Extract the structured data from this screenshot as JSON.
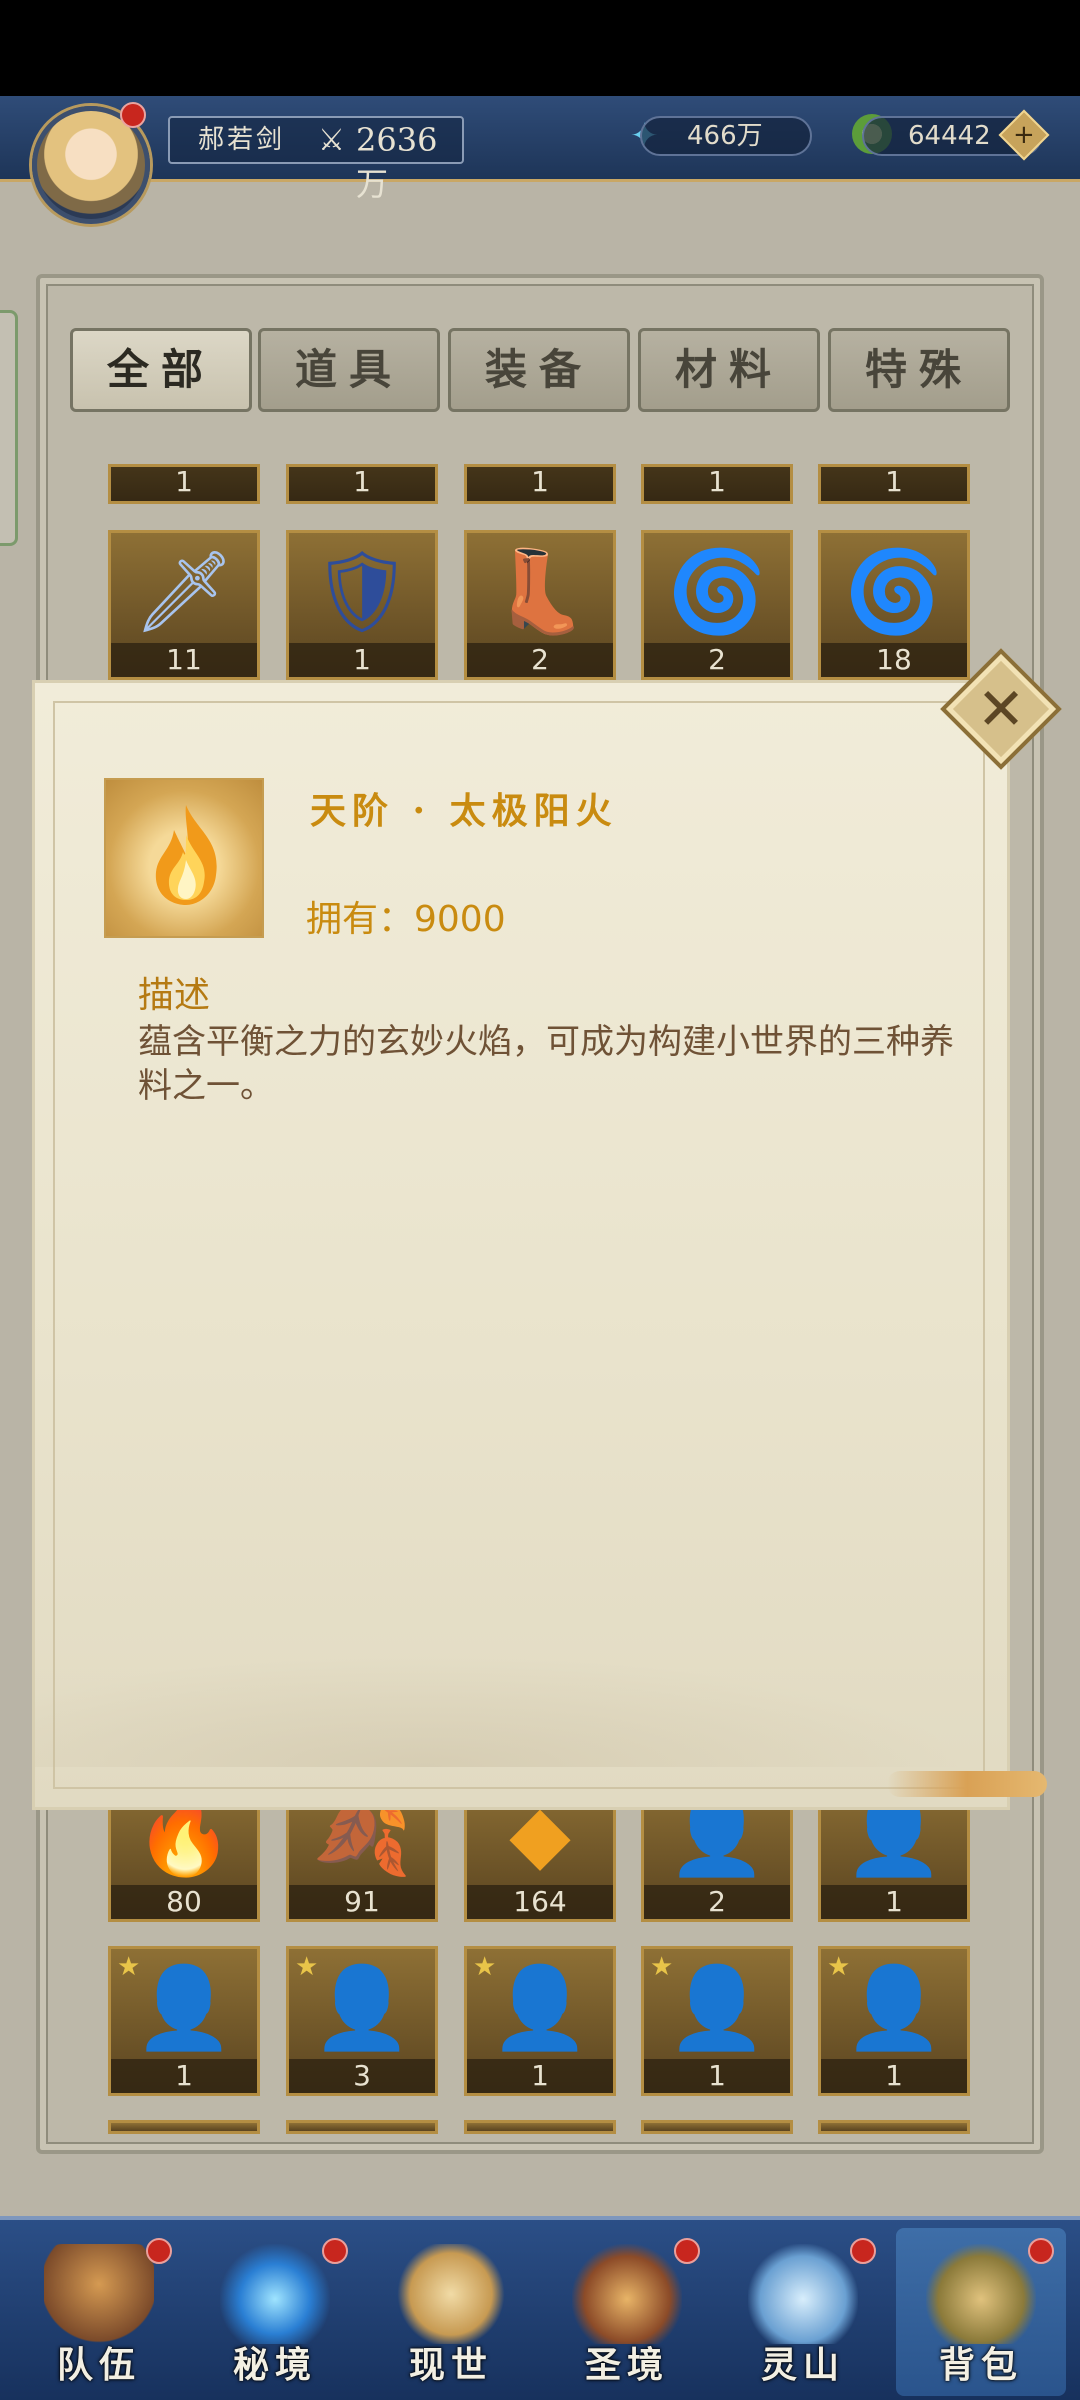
{
  "header": {
    "player_name": "郝若剑",
    "combat_power": "2636万",
    "currency1": "466万",
    "currency2": "64442"
  },
  "tabs": [
    "全部",
    "道具",
    "装备",
    "材料",
    "特殊"
  ],
  "grid_row_top": [
    "1",
    "1",
    "1",
    "1",
    "1"
  ],
  "grid_row_2": [
    "11",
    "1",
    "2",
    "2",
    "18"
  ],
  "grid_row_3": [
    "80",
    "91",
    "164",
    "2",
    "1"
  ],
  "grid_row_4": [
    "1",
    "3",
    "1",
    "1",
    "1"
  ],
  "dialog": {
    "item_name": "天阶 · 太极阳火",
    "owned_label": "拥有：9000",
    "description_heading": "描述",
    "description": "蕴含平衡之力的玄妙火焰，可成为构建小世界的三种养料之一。"
  },
  "nav": {
    "items": [
      "队伍",
      "秘境",
      "现世",
      "圣境",
      "灵山",
      "背包"
    ]
  },
  "colors": {
    "title_gold": "#c98b10",
    "desc_brown": "#6f5236",
    "header_blue": "#1e3558"
  }
}
